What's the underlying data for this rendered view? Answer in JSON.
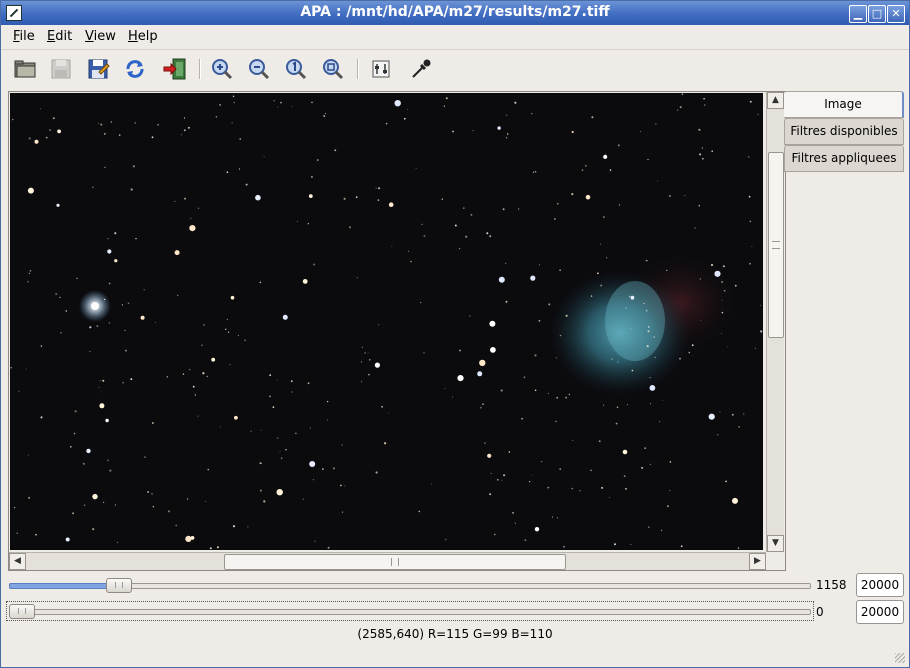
{
  "window": {
    "title": "APA : /mnt/hd/APA/m27/results/m27.tiff"
  },
  "menu": {
    "items": [
      "File",
      "Edit",
      "View",
      "Help"
    ]
  },
  "toolbar": {
    "icons": [
      "open-folder-icon",
      "save-disabled-icon",
      "save-as-icon",
      "refresh-icon",
      "exit-icon",
      "zoom-in-icon",
      "zoom-out-icon",
      "zoom-fit-icon",
      "zoom-full-icon",
      "levels-icon",
      "color-picker-icon"
    ]
  },
  "tabs": [
    "Image",
    "Filtres disponibles",
    "Filtres appliquees"
  ],
  "sliders": [
    {
      "value_label": "1158",
      "max_value": "20000",
      "fraction": 0.07
    },
    {
      "value_label": "0",
      "max_value": "20000",
      "fraction": 0.0
    }
  ],
  "status": {
    "text": "(2585,640) R=115 G=99 B=110"
  },
  "colors": {
    "title_bar": "#3e6ac0",
    "slider_fill": "#7fa4e0",
    "sky": "#0a0a0c",
    "nebula": "#4fa3b8"
  }
}
